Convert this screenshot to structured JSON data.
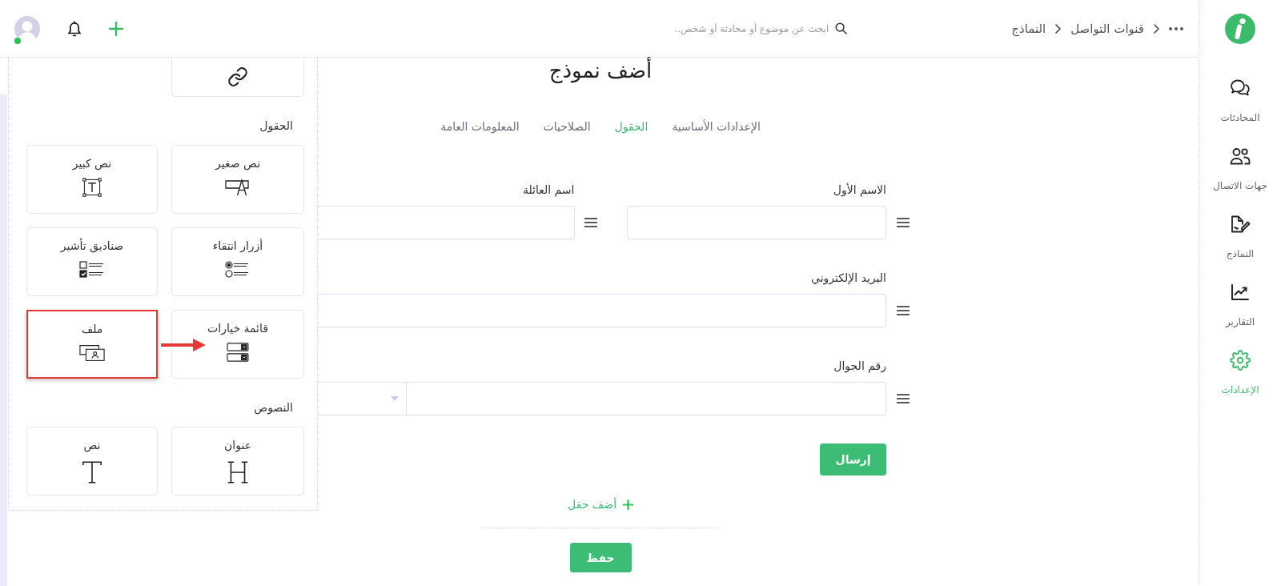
{
  "topbar": {
    "breadcrumb": [
      "قنوات التواصل",
      "النماذج"
    ],
    "search": {
      "placeholder": "ابحث عن موضوع أو محادثة أو شخص.."
    },
    "user": {
      "online": true
    }
  },
  "sidebar": {
    "items": [
      {
        "label": "المحادثات",
        "selected": false
      },
      {
        "label": "جهات الاتصال",
        "selected": false
      },
      {
        "label": "النماذج",
        "selected": false
      },
      {
        "label": "التقارير",
        "selected": false
      },
      {
        "label": "الإعدادات",
        "selected": true
      }
    ]
  },
  "palette": {
    "sections": [
      {
        "title": "الحقول",
        "items": [
          {
            "label": "نص صغير",
            "highlighted": false
          },
          {
            "label": "نص كبير",
            "highlighted": false
          },
          {
            "label": "أزرار انتقاء",
            "highlighted": false
          },
          {
            "label": "صناديق تأشير",
            "highlighted": false
          },
          {
            "label": "قائمة خيارات",
            "highlighted": false
          },
          {
            "label": "ملف",
            "highlighted": true
          }
        ]
      },
      {
        "title": "النصوص",
        "items": [
          {
            "label": "عنوان",
            "highlighted": false
          },
          {
            "label": "نص",
            "highlighted": false
          }
        ]
      }
    ]
  },
  "form": {
    "title": "أضف نموذج",
    "tabs": [
      {
        "label": "الإعدادات الأساسية",
        "selected": false
      },
      {
        "label": "الحقول",
        "selected": true
      },
      {
        "label": "الصلاحيات",
        "selected": false
      },
      {
        "label": "المعلومات العامة",
        "selected": false
      }
    ],
    "rows": [
      {
        "fields": [
          {
            "label": "الاسم الأول",
            "kind": "text"
          },
          {
            "label": "اسم العائلة",
            "kind": "text"
          }
        ]
      },
      {
        "fields": [
          {
            "label": "البريد الإلكتروني",
            "kind": "text"
          }
        ]
      },
      {
        "fields": [
          {
            "label": "رقم الجوال",
            "kind": "phone"
          }
        ]
      }
    ],
    "submit": "إرسال",
    "add_field": "أضف حقل",
    "save": "حفظ"
  }
}
